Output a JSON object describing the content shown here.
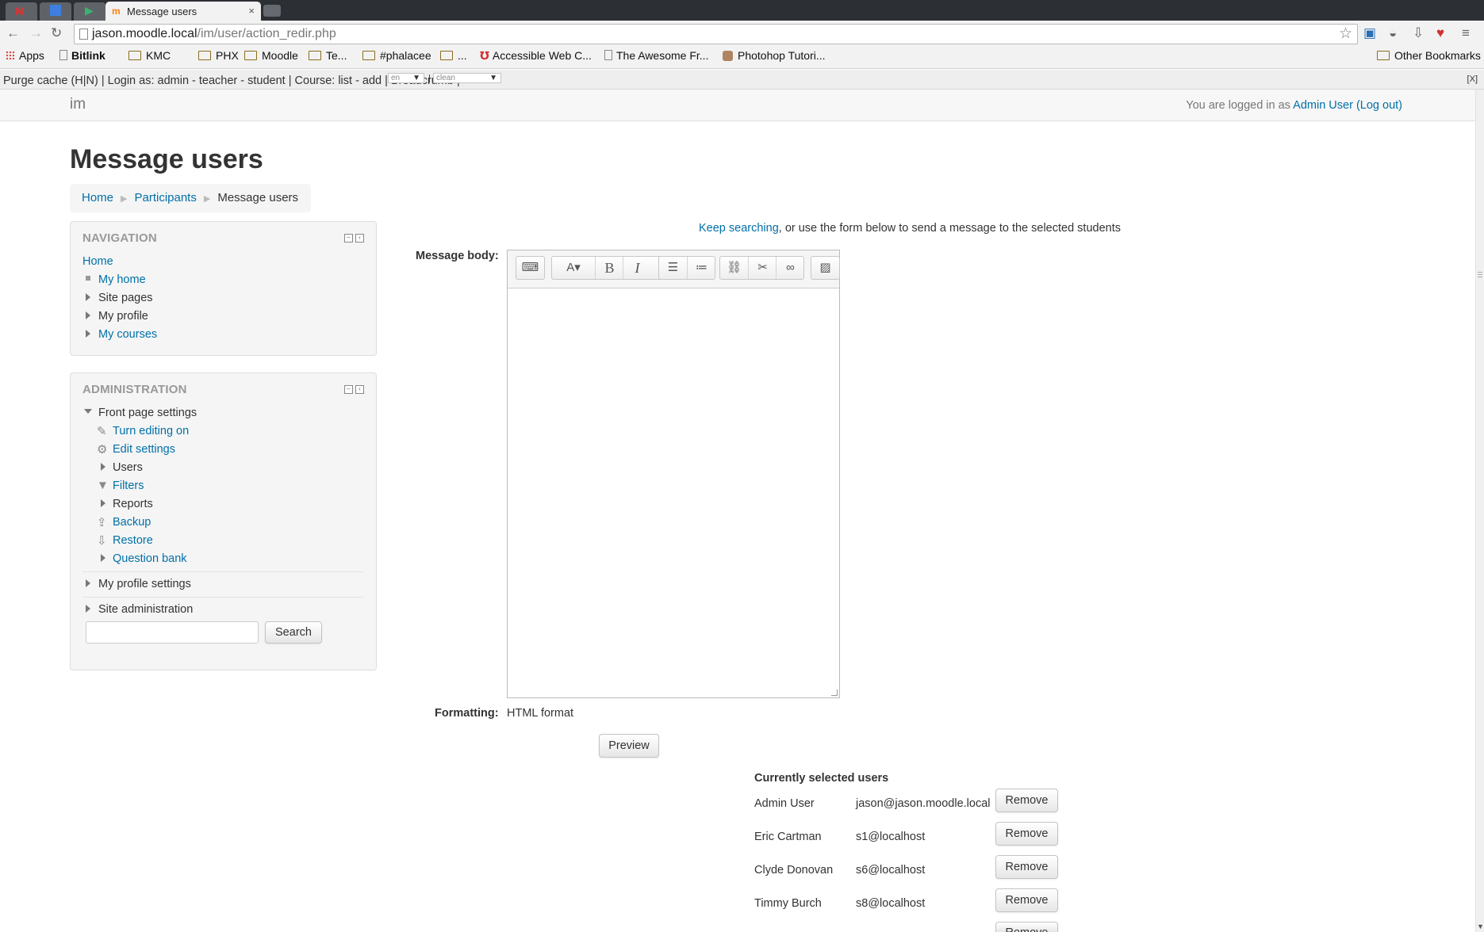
{
  "browser": {
    "tab_title": "Message users",
    "tab_close": "×",
    "url_host": "jason.moodle.local",
    "url_path": "/im/user/action_redir.php",
    "bookmarks": [
      "Apps",
      "Bitlink",
      "KMC",
      "PHX",
      "Moodle",
      "Te...",
      "#phalacee",
      "...",
      "Accessible Web C...",
      "The Awesome Fr...",
      "Photohop Tutori..."
    ],
    "other_bookmarks": "Other Bookmarks"
  },
  "devbar": {
    "text": "Purge cache (H|N) | Login as: admin - teacher - student | Course: list - add | Breadcrumb |",
    "lang": "en",
    "theme": "clean",
    "close": "[X]"
  },
  "header": {
    "site_name": "im",
    "logged_in_prefix": "You are logged in as",
    "user_name": "Admin User",
    "logout": "(Log out)"
  },
  "page": {
    "title": "Message users",
    "breadcrumb": [
      "Home",
      "Participants",
      "Message users"
    ]
  },
  "navigation": {
    "title": "NAVIGATION",
    "home": "Home",
    "items": [
      "My home",
      "Site pages",
      "My profile",
      "My courses"
    ]
  },
  "administration": {
    "title": "ADMINISTRATION",
    "front_page_settings": "Front page settings",
    "sub_items": [
      "Turn editing on",
      "Edit settings",
      "Users",
      "Filters",
      "Reports",
      "Backup",
      "Restore",
      "Question bank"
    ],
    "my_profile_settings": "My profile settings",
    "site_administration": "Site administration",
    "search_button": "Search"
  },
  "main": {
    "keep_searching": "Keep searching",
    "keep_rest": ", or use the form below to send a message to the selected students",
    "message_body_label": "Message body:",
    "formatting_label": "Formatting:",
    "formatting_value": "HTML format",
    "preview_button": "Preview",
    "selected_title": "Currently selected users",
    "remove_label": "Remove",
    "selected_users": [
      {
        "name": "Admin User",
        "email": "jason@jason.moodle.local"
      },
      {
        "name": "Eric Cartman",
        "email": "s1@localhost"
      },
      {
        "name": "Clyde Donovan",
        "email": "s6@localhost"
      },
      {
        "name": "Timmy Burch",
        "email": "s8@localhost"
      }
    ]
  }
}
